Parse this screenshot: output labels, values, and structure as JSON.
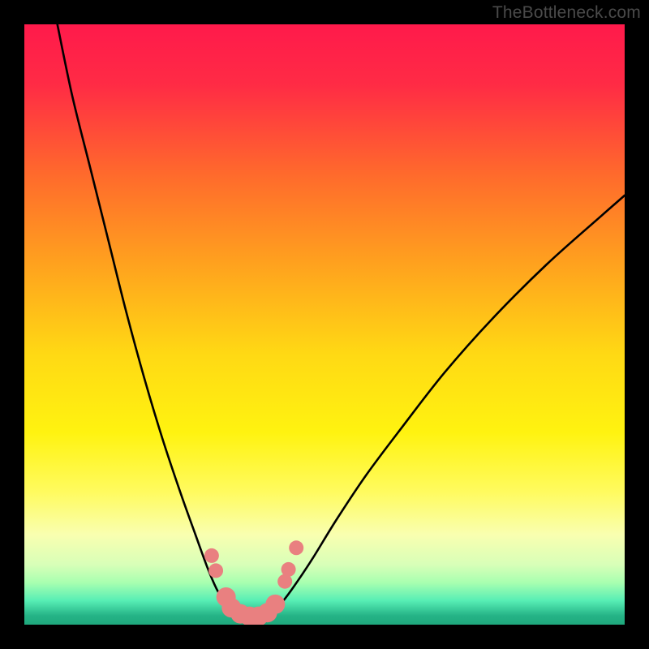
{
  "watermark": "TheBottleneck.com",
  "chart_data": {
    "type": "line",
    "title": "",
    "xlabel": "",
    "ylabel": "",
    "xlim": [
      0,
      100
    ],
    "ylim": [
      0,
      100
    ],
    "background_gradient": {
      "stops": [
        {
          "offset": 0.0,
          "color": "#ff1a4b"
        },
        {
          "offset": 0.1,
          "color": "#ff2b45"
        },
        {
          "offset": 0.25,
          "color": "#ff6a2c"
        },
        {
          "offset": 0.4,
          "color": "#ffa21e"
        },
        {
          "offset": 0.55,
          "color": "#ffd914"
        },
        {
          "offset": 0.68,
          "color": "#fff310"
        },
        {
          "offset": 0.78,
          "color": "#fffb60"
        },
        {
          "offset": 0.85,
          "color": "#f9ffb0"
        },
        {
          "offset": 0.9,
          "color": "#d8ffb8"
        },
        {
          "offset": 0.93,
          "color": "#a8ffb0"
        },
        {
          "offset": 0.96,
          "color": "#57eeb5"
        },
        {
          "offset": 0.985,
          "color": "#25b386"
        },
        {
          "offset": 1.0,
          "color": "#1fa97d"
        }
      ]
    },
    "series": [
      {
        "name": "left-curve",
        "stroke": "#000000",
        "x": [
          5.5,
          8,
          11,
          14,
          17,
          20,
          23,
          26,
          28.5,
          30.5,
          32,
          33.3,
          34.5
        ],
        "values": [
          100,
          88,
          76,
          64,
          52,
          41,
          31,
          22,
          15,
          9.5,
          6,
          3.7,
          2.2
        ]
      },
      {
        "name": "right-curve",
        "stroke": "#000000",
        "x": [
          41.5,
          43,
          45,
          48,
          52,
          57,
          63,
          70,
          78,
          87,
          96,
          100
        ],
        "values": [
          2.2,
          3.8,
          6.5,
          11,
          17.5,
          25,
          33,
          42,
          51,
          60,
          68,
          71.5
        ]
      },
      {
        "name": "floor",
        "stroke": "#000000",
        "x": [
          34.5,
          36,
          37,
          38,
          39,
          40,
          41.5
        ],
        "values": [
          2.2,
          1.4,
          1.1,
          1.0,
          1.1,
          1.4,
          2.2
        ]
      }
    ],
    "data_points": {
      "color": "#e98080",
      "radius_small": 9,
      "radius_large": 12,
      "points": [
        {
          "x": 31.2,
          "y": 11.5,
          "r": "small"
        },
        {
          "x": 31.9,
          "y": 9.0,
          "r": "small"
        },
        {
          "x": 33.6,
          "y": 4.6,
          "r": "large"
        },
        {
          "x": 34.5,
          "y": 2.8,
          "r": "large"
        },
        {
          "x": 36.0,
          "y": 1.8,
          "r": "large"
        },
        {
          "x": 37.5,
          "y": 1.4,
          "r": "large"
        },
        {
          "x": 39.0,
          "y": 1.4,
          "r": "large"
        },
        {
          "x": 40.5,
          "y": 2.0,
          "r": "large"
        },
        {
          "x": 41.8,
          "y": 3.4,
          "r": "large"
        },
        {
          "x": 43.4,
          "y": 7.2,
          "r": "small"
        },
        {
          "x": 44.0,
          "y": 9.2,
          "r": "small"
        },
        {
          "x": 45.3,
          "y": 12.8,
          "r": "small"
        }
      ]
    }
  }
}
